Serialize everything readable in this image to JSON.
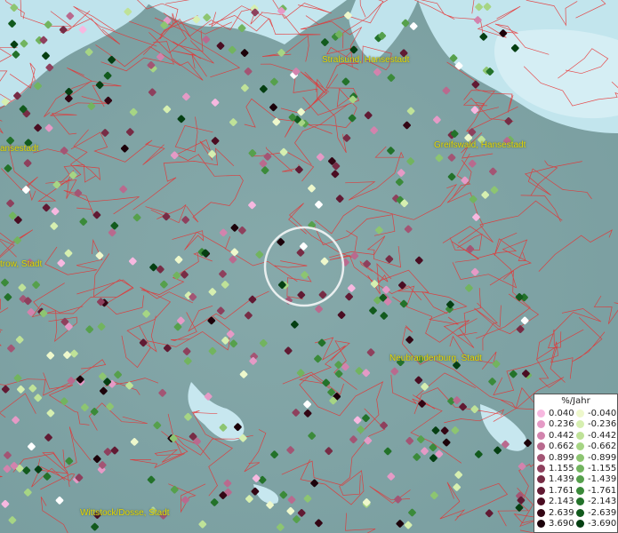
{
  "places": [
    {
      "name": "Stralsund, Hansestadt"
    },
    {
      "name": "Greifswald, Hansestadt"
    },
    {
      "name": "ansestadt"
    },
    {
      "name": "trow, Stadt"
    },
    {
      "name": "Neubrandenburg, Stadt"
    },
    {
      "name": "Wittstock/Dosse, Stadt"
    }
  ],
  "legend": {
    "title": "%/Jahr",
    "positive": [
      "0.040",
      "0.236",
      "0.442",
      "0.662",
      "0.899",
      "1.155",
      "1.439",
      "1.761",
      "2.143",
      "2.639",
      "3.690"
    ],
    "negative": [
      "-0.040",
      "-0.236",
      "-0.442",
      "-0.662",
      "-0.899",
      "-1.155",
      "-1.439",
      "-1.761",
      "-2.143",
      "-2.639",
      "-3.690"
    ],
    "positive_colors": [
      "#f7b8e0",
      "#e59ac6",
      "#d283ad",
      "#b96a8e",
      "#a35574",
      "#8e405d",
      "#772c45",
      "#611a33",
      "#4a0d22",
      "#330614",
      "#1c020a"
    ],
    "negative_colors": [
      "#eef8cc",
      "#d6efb0",
      "#bfe298",
      "#a6d584",
      "#8dc571",
      "#72b45f",
      "#56a04c",
      "#3b8a3a",
      "#23722a",
      "#125a1d",
      "#053f12"
    ]
  },
  "colors": {
    "water": "#b8dfe8",
    "land": "#7fa3a5",
    "borders": "#e83030",
    "label": "#e8d800"
  }
}
